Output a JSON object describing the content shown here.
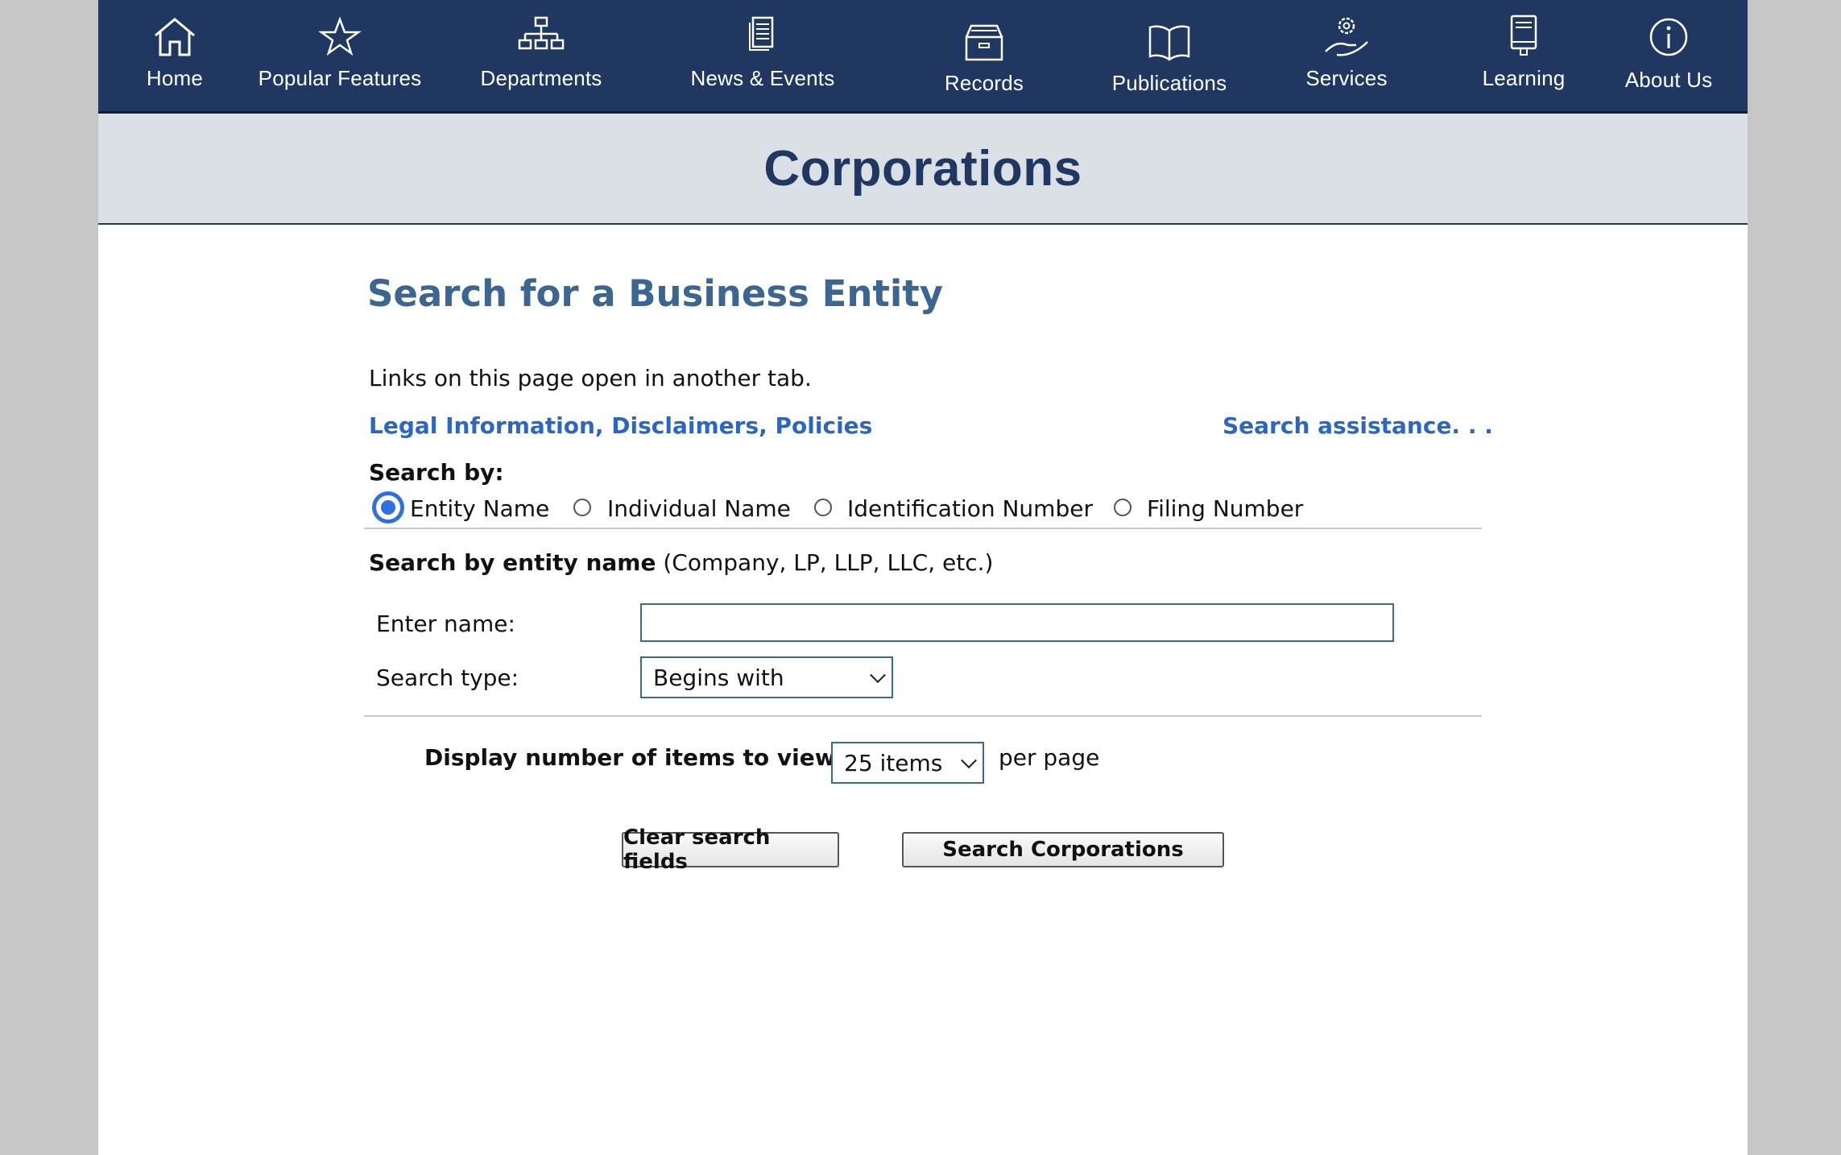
{
  "nav": {
    "items": [
      {
        "label": "Home",
        "icon": "home-icon"
      },
      {
        "label": "Popular Features",
        "icon": "star-icon"
      },
      {
        "label": "Departments",
        "icon": "org-chart-icon"
      },
      {
        "label": "News & Events",
        "icon": "news-icon"
      },
      {
        "label": "Records",
        "icon": "archive-box-icon"
      },
      {
        "label": "Publications",
        "icon": "open-book-icon"
      },
      {
        "label": "Services",
        "icon": "hand-gear-icon"
      },
      {
        "label": "Learning",
        "icon": "book-icon"
      },
      {
        "label": "About Us",
        "icon": "info-icon"
      }
    ]
  },
  "banner": {
    "title": "Corporations"
  },
  "main": {
    "heading": "Search for a Business Entity",
    "intro": "Links on this page open in another tab.",
    "legal_link": "Legal Information, Disclaimers, Policies",
    "assist_link": "Search assistance. . .",
    "search_by_label": "Search by:",
    "radio_options": [
      {
        "label": "Entity Name",
        "checked": true
      },
      {
        "label": "Individual Name",
        "checked": false
      },
      {
        "label": "Identification Number",
        "checked": false
      },
      {
        "label": "Filing Number",
        "checked": false
      }
    ],
    "section_heading_bold": "Search by entity name",
    "section_heading_rest": "(Company, LP, LLP, LLC, etc.)",
    "enter_name_label": "Enter name:",
    "enter_name_value": "",
    "search_type_label": "Search type:",
    "search_type_value": "Begins with",
    "display_label": "Display number of items to view:",
    "display_value": "25 items",
    "per_page": "per page",
    "clear_button": "Clear search fields",
    "search_button": "Search Corporations"
  },
  "colors": {
    "nav_bg": "#1f3761",
    "banner_bg": "#dbdfe6",
    "heading": "#3c668f",
    "link": "#2b66c2"
  }
}
